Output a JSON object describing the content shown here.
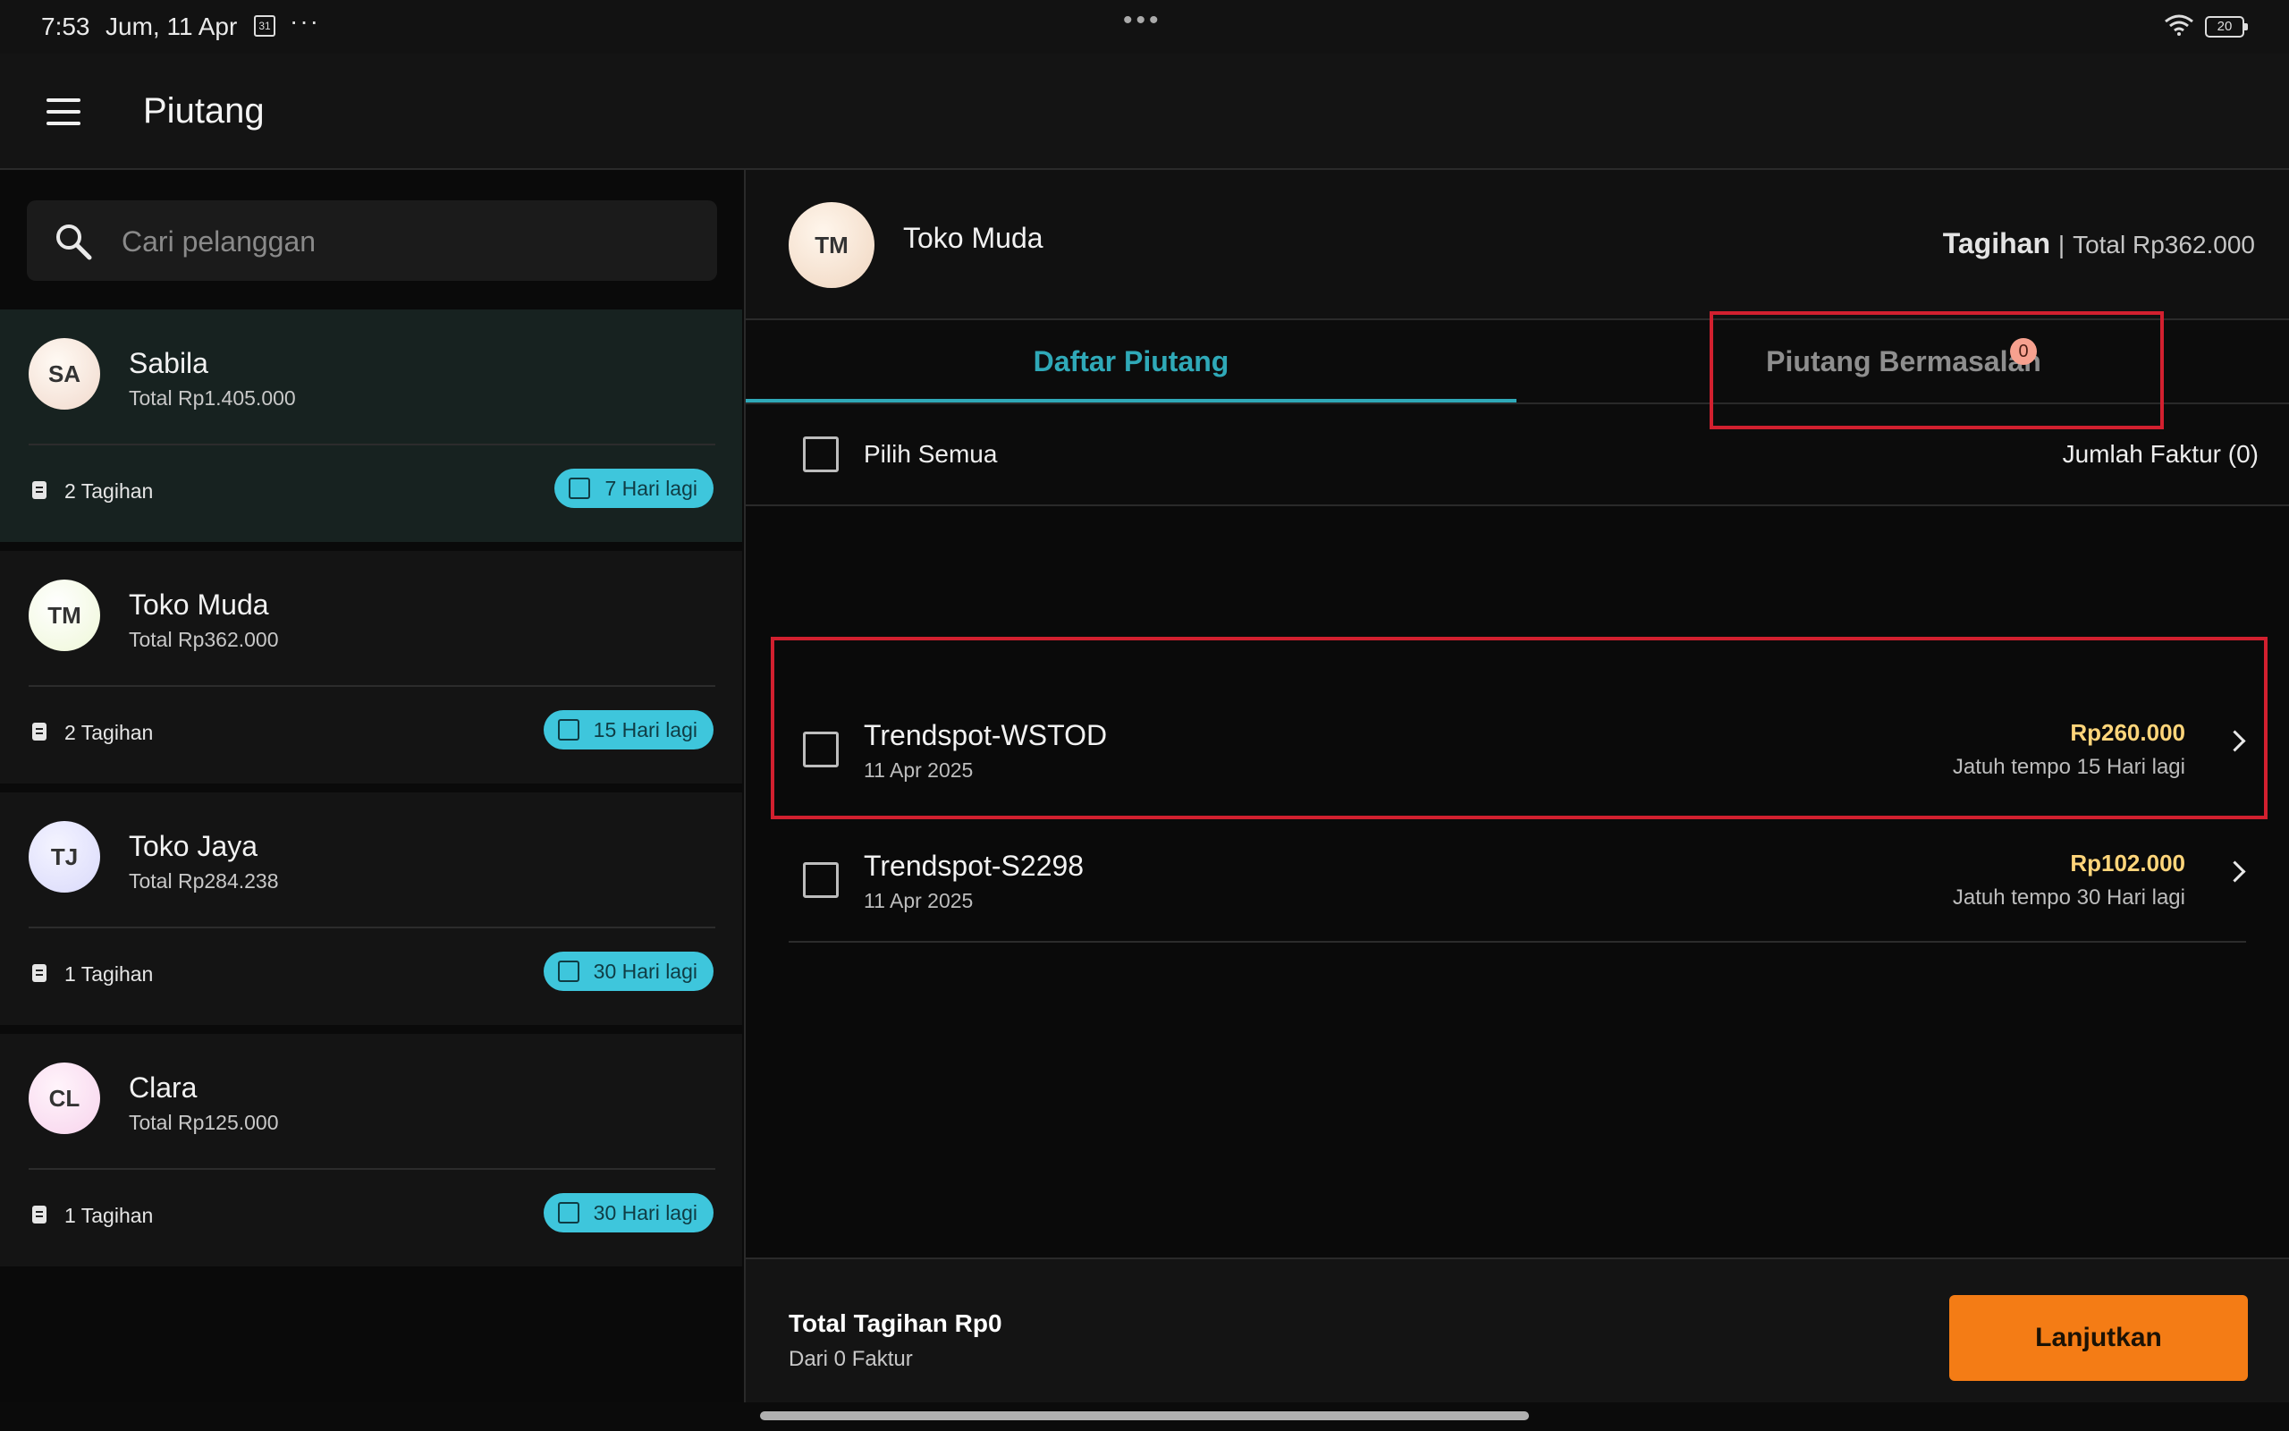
{
  "status_bar": {
    "time": "7:53",
    "date": "Jum, 11 Apr",
    "calendar_day": "31",
    "more": "···",
    "center": "•••",
    "battery": "20"
  },
  "app_bar": {
    "title": "Piutang"
  },
  "search": {
    "placeholder": "Cari pelanggan",
    "value": ""
  },
  "customers": [
    {
      "initials": "SA",
      "name": "Sabila",
      "total": "Total Rp1.405.000",
      "count": "2 Tagihan",
      "badge": "7 Hari lagi",
      "avatar_color": "#f1d9cc",
      "selected": true
    },
    {
      "initials": "TM",
      "name": "Toko Muda",
      "total": "Total Rp362.000",
      "count": "2 Tagihan",
      "badge": "15 Hari lagi",
      "avatar_color": "#eef7d7",
      "selected": false
    },
    {
      "initials": "TJ",
      "name": "Toko Jaya",
      "total": "Total Rp284.238",
      "count": "1 Tagihan",
      "badge": "30 Hari lagi",
      "avatar_color": "#d9d9fb",
      "selected": false
    },
    {
      "initials": "CL",
      "name": "Clara",
      "total": "Total Rp125.000",
      "count": "1 Tagihan",
      "badge": "30 Hari lagi",
      "avatar_color": "#f7d3ec",
      "selected": false
    }
  ],
  "detail": {
    "initials": "TM",
    "name": "Toko Muda",
    "tagihan_label": "Tagihan",
    "separator": "|",
    "total": "Total Rp362.000",
    "tabs": [
      {
        "label": "Daftar Piutang",
        "active": true
      },
      {
        "label": "Piutang Bermasalah",
        "count": "0",
        "active": false
      }
    ],
    "select_all": "Pilih Semua",
    "invoice_count": "Jumlah Faktur (0)",
    "invoices": [
      {
        "name": "Trendspot-WSTOD",
        "date": "11 Apr 2025",
        "amount": "Rp260.000",
        "due": "Jatuh tempo 15 Hari lagi"
      },
      {
        "name": "Trendspot-S2298",
        "date": "11 Apr 2025",
        "amount": "Rp102.000",
        "due": "Jatuh tempo 30 Hari lagi"
      }
    ],
    "footer": {
      "total": "Total Tagihan Rp0",
      "sub": "Dari 0 Faktur",
      "button": "Lanjutkan"
    }
  },
  "colors": {
    "accent": "#2fa9b8",
    "badge": "#3ec6dc",
    "amount": "#ffd57a",
    "primary_button": "#f47c15",
    "highlight": "#d2202f"
  }
}
